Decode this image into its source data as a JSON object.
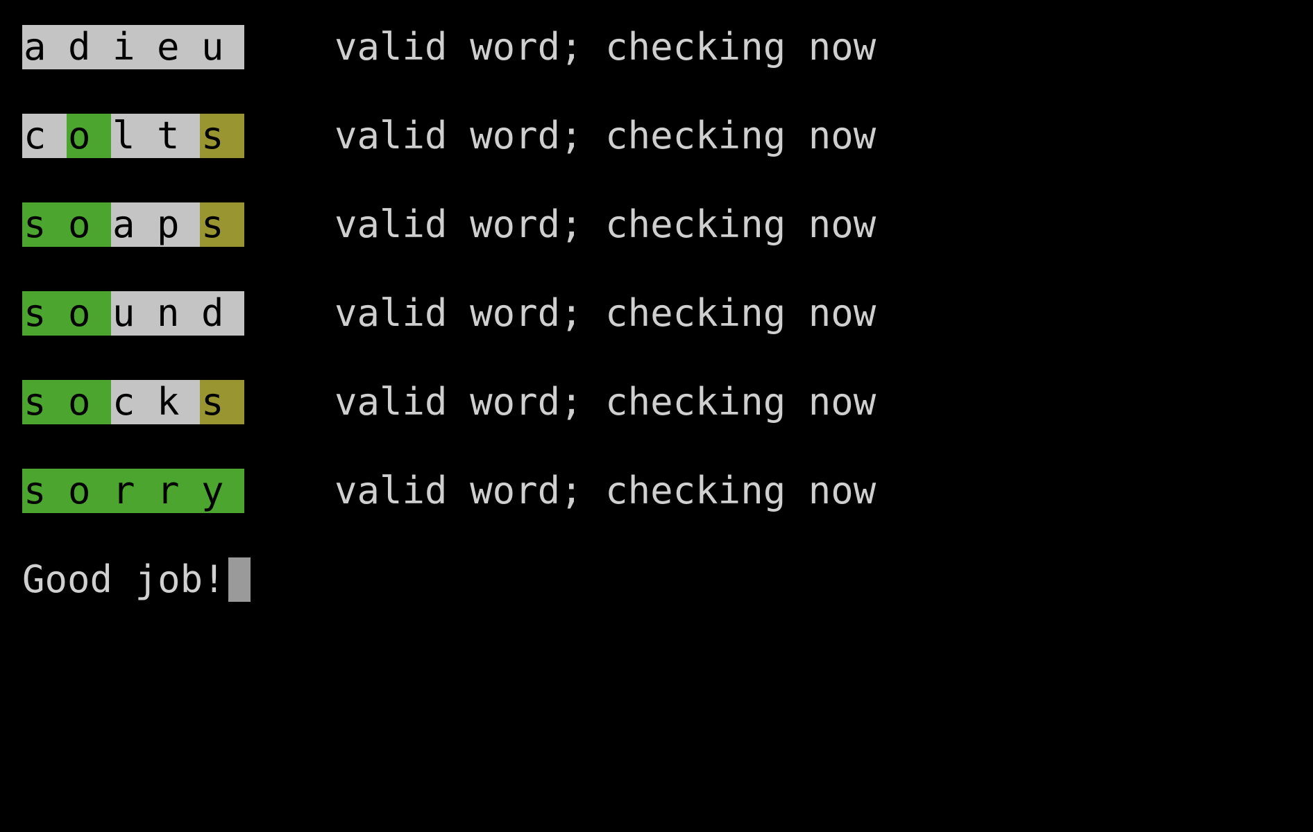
{
  "terminal": {
    "background": "#000000",
    "colors": {
      "gray": "#c4c4c4",
      "green": "#4ba52f",
      "yellow": "#999632",
      "cursor": "#9a9a9a"
    },
    "guesses": [
      {
        "word": "adieu",
        "letters": [
          "a",
          "d",
          "i",
          "e",
          "u"
        ],
        "states": [
          "gray",
          "gray",
          "gray",
          "gray",
          "gray"
        ],
        "message": "valid word; checking now"
      },
      {
        "word": "colts",
        "letters": [
          "c",
          "o",
          "l",
          "t",
          "s"
        ],
        "states": [
          "gray",
          "green",
          "gray",
          "gray",
          "yellow"
        ],
        "message": "valid word; checking now"
      },
      {
        "word": "soaps",
        "letters": [
          "s",
          "o",
          "a",
          "p",
          "s"
        ],
        "states": [
          "green",
          "green",
          "gray",
          "gray",
          "yellow"
        ],
        "message": "valid word; checking now"
      },
      {
        "word": "sound",
        "letters": [
          "s",
          "o",
          "u",
          "n",
          "d"
        ],
        "states": [
          "green",
          "green",
          "gray",
          "gray",
          "gray"
        ],
        "message": "valid word; checking now"
      },
      {
        "word": "socks",
        "letters": [
          "s",
          "o",
          "c",
          "k",
          "s"
        ],
        "states": [
          "green",
          "green",
          "gray",
          "gray",
          "yellow"
        ],
        "message": "valid word; checking now"
      },
      {
        "word": "sorry",
        "letters": [
          "s",
          "o",
          "r",
          "r",
          "y"
        ],
        "states": [
          "green",
          "green",
          "green",
          "green",
          "green"
        ],
        "message": "valid word; checking now"
      }
    ],
    "final_message": "Good job!"
  }
}
